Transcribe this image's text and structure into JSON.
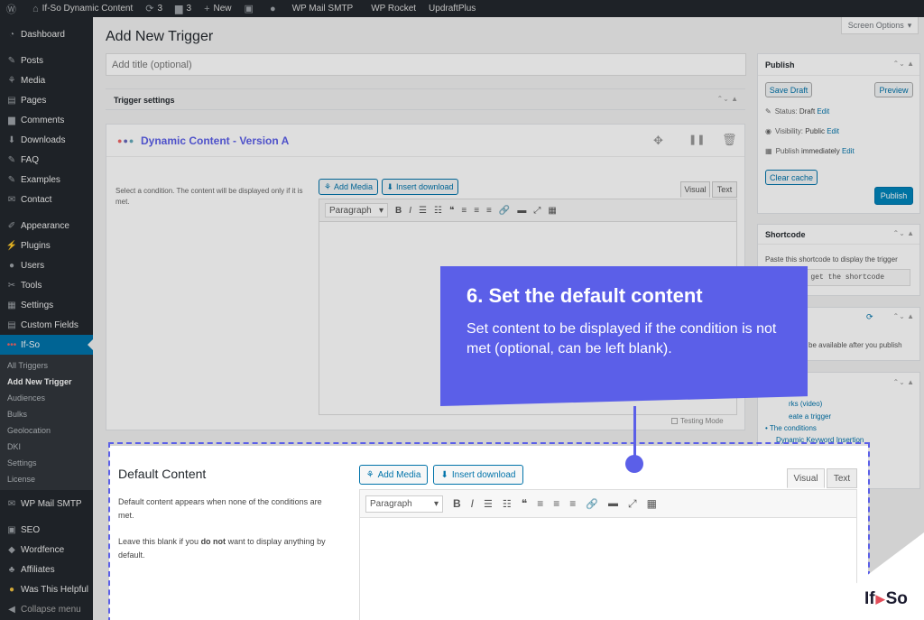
{
  "admin_bar": {
    "site_title": "If-So Dynamic Content",
    "updates_count": "3",
    "comments_count": "3",
    "new_label": "New",
    "plugins": [
      "WP Mail SMTP",
      "WP Rocket",
      "UpdraftPlus"
    ]
  },
  "sidebar": {
    "items_top": [
      {
        "label": "Dashboard",
        "icon": "dashboard-icon"
      }
    ],
    "items_content": [
      {
        "label": "Posts",
        "icon": "pin-icon"
      },
      {
        "label": "Media",
        "icon": "media-icon"
      },
      {
        "label": "Pages",
        "icon": "page-icon"
      },
      {
        "label": "Comments",
        "icon": "comment-icon"
      },
      {
        "label": "Downloads",
        "icon": "download-icon"
      },
      {
        "label": "FAQ",
        "icon": "pin-icon"
      },
      {
        "label": "Examples",
        "icon": "pin-icon"
      },
      {
        "label": "Contact",
        "icon": "mail-icon"
      }
    ],
    "items_admin": [
      {
        "label": "Appearance",
        "icon": "brush-icon"
      },
      {
        "label": "Plugins",
        "icon": "plug-icon"
      },
      {
        "label": "Users",
        "icon": "user-icon"
      },
      {
        "label": "Tools",
        "icon": "wrench-icon"
      },
      {
        "label": "Settings",
        "icon": "settings-icon"
      },
      {
        "label": "Custom Fields",
        "icon": "list-icon"
      }
    ],
    "current_item": "If-So",
    "submenu": [
      "All Triggers",
      "Add New Trigger",
      "Audiences",
      "Bulks",
      "Geolocation",
      "DKI",
      "Settings",
      "License"
    ],
    "items_bottom": [
      {
        "label": "WP Mail SMTP",
        "icon": "smtp-icon"
      },
      {
        "label": "SEO",
        "icon": "seo-icon"
      },
      {
        "label": "Wordfence",
        "icon": "shield-icon"
      },
      {
        "label": "Affiliates",
        "icon": "affiliates-icon"
      },
      {
        "label": "Was This Helpful",
        "icon": "question-icon"
      },
      {
        "label": "Collapse menu",
        "icon": "collapse-icon"
      }
    ]
  },
  "page": {
    "title": "Add New Trigger",
    "screen_options": "Screen Options",
    "title_placeholder": "Add title (optional)",
    "trigger_settings": "Trigger settings"
  },
  "version_a": {
    "title": "Dynamic Content - Version A",
    "condition_text": "Select a condition. The content will be displayed only if it is met.",
    "add_media": "Add Media",
    "insert_download": "Insert download",
    "tab_visual": "Visual",
    "tab_text": "Text",
    "format_select": "Paragraph",
    "testing_mode": "Testing Mode"
  },
  "default_content": {
    "title": "Default Content",
    "description1": "Default content appears when none of the conditions are met.",
    "description2_prefix": "Leave this blank if you ",
    "description2_bold": "do not",
    "description2_suffix": " want to display anything by default.",
    "add_media": "Add Media",
    "insert_download": "Insert download",
    "tab_visual": "Visual",
    "tab_text": "Text",
    "format_select": "Paragraph"
  },
  "publish_box": {
    "title": "Publish",
    "save_draft": "Save Draft",
    "preview": "Preview",
    "status_label": "Status: ",
    "status_value": "Draft",
    "visibility_label": "Visibility: ",
    "visibility_value": "Public",
    "publish_label": "Publish ",
    "publish_value": "immediately",
    "edit": "Edit",
    "clear_cache": "Clear cache",
    "publish_button": "Publish"
  },
  "shortcode_box": {
    "title": "Shortcode",
    "text": "Paste this shortcode to display the trigger",
    "code_fragment": "o get the shortcode"
  },
  "analytics_box": {
    "text_fragment": "be available after you publish"
  },
  "help_box": {
    "link1": "rks (video)",
    "link2": "eate a trigger",
    "link3": "The conditions",
    "link4": "Dynamic Keyword Insertion"
  },
  "callout": {
    "title": "6. Set the default content",
    "body": "Set content to be displayed if the condition is not met (optional, can be left blank)."
  },
  "brand": {
    "logo_text_left": "If",
    "logo_text_right": "So",
    "accent": "#5b5fe8",
    "wp_blue": "#0073aa"
  }
}
